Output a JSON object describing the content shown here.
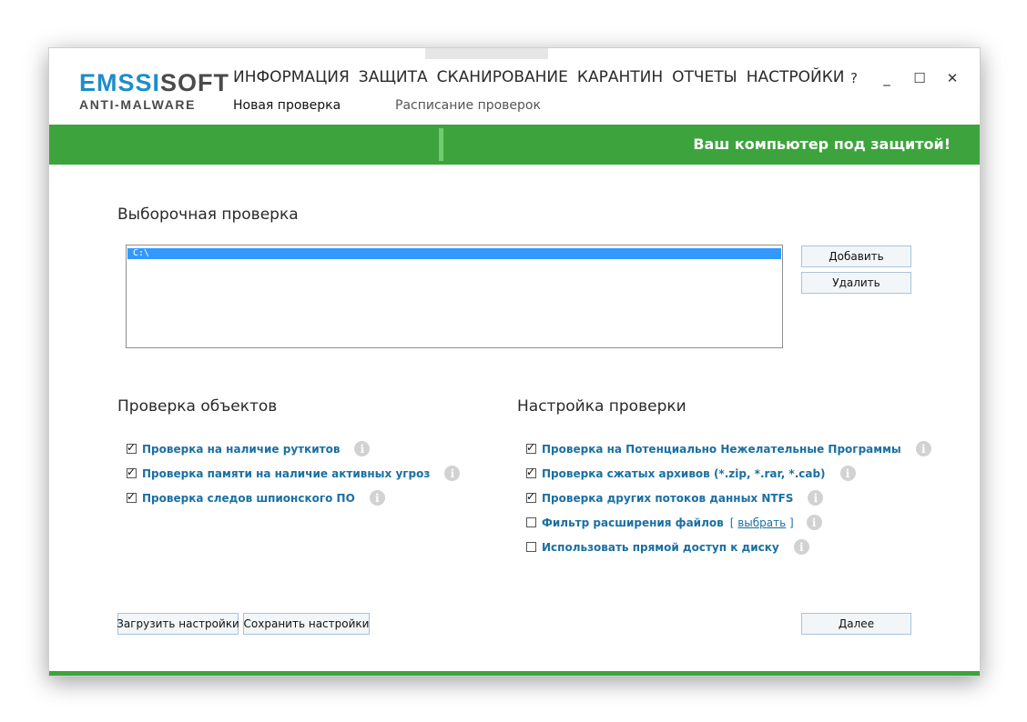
{
  "brand": {
    "logo_accent": "EMS",
    "logo_accent2": "SI",
    "logo_rest": "SOFT",
    "logo_sub": "ANTI-MALWARE"
  },
  "nav": {
    "items": [
      "ИНФОРМАЦИЯ",
      "ЗАЩИТА",
      "СКАНИРОВАНИЕ",
      "КАРАНТИН",
      "ОТЧЕТЫ",
      "НАСТРОЙКИ"
    ],
    "sub_items": [
      "Новая проверка",
      "Расписание проверок"
    ]
  },
  "window_controls": {
    "help": "?",
    "minimize": "_",
    "maximize": "☐",
    "close": "✕"
  },
  "status": {
    "text": "Ваш компьютер под защитой!"
  },
  "custom_scan": {
    "title": "Выборочная проверка",
    "paths": [
      "C:\\"
    ],
    "add_button": "Добавить",
    "remove_button": "Удалить"
  },
  "objects": {
    "title": "Проверка объектов",
    "options": [
      {
        "label": "Проверка на наличие руткитов",
        "checked": true
      },
      {
        "label": "Проверка памяти на наличие активных угроз",
        "checked": true
      },
      {
        "label": "Проверка следов шпионского ПО",
        "checked": true
      }
    ]
  },
  "scan_settings": {
    "title": "Настройка проверки",
    "options": [
      {
        "label": "Проверка на Потенциально Нежелательные Программы",
        "checked": true
      },
      {
        "label": "Проверка сжатых архивов (*.zip, *.rar, *.cab)",
        "checked": true
      },
      {
        "label": "Проверка других потоков данных NTFS",
        "checked": true
      },
      {
        "label": "Фильтр расширения файлов",
        "checked": false
      },
      {
        "label": "Использовать прямой доступ к диску",
        "checked": false
      }
    ],
    "filter_link_open": "[ ",
    "filter_link": "выбрать",
    "filter_link_close": " ]"
  },
  "footer": {
    "load_button": "Загрузить настройки",
    "save_button": "Сохранить настройки",
    "next_button": "Далее"
  },
  "icons": {
    "info": "i",
    "tick": "✓"
  },
  "colors": {
    "brand_green": "#3da43d",
    "brand_blue": "#1b8ec9",
    "link_blue": "#1a6fa3",
    "selection": "#3399ff"
  }
}
